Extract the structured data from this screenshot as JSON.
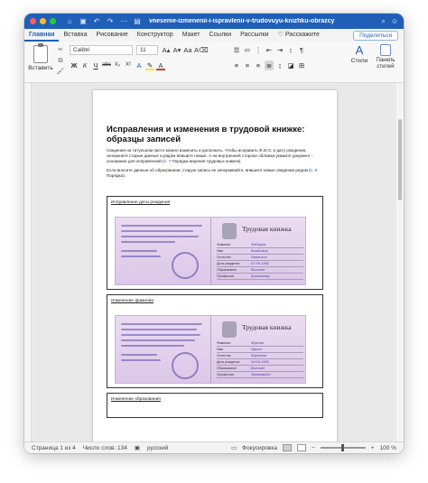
{
  "window": {
    "title": "vnesenie-izmenenii-i-ispravlenii-v-trudovuyu-knizhku-obrazcy"
  },
  "quick_access": [
    "home-icon",
    "save-icon",
    "undo-icon",
    "redo-icon",
    "more-icon",
    "word-doc-icon"
  ],
  "tabs": {
    "items": [
      "Главная",
      "Вставка",
      "Рисование",
      "Конструктор",
      "Макет",
      "Ссылки",
      "Рассылки"
    ],
    "active": "Главная",
    "tell_me": "Расскажите",
    "share": "Поделиться"
  },
  "ribbon": {
    "paste_label": "Вставить",
    "font_name": "Calibri",
    "font_size": "11",
    "bold": "Ж",
    "italic": "К",
    "underline": "Ч",
    "strike": "abc",
    "subscript": "X₂",
    "superscript": "X²",
    "styles_label": "Стили",
    "styles_pane_label": "Панель стилей"
  },
  "document": {
    "heading": "Исправления и изменения в трудовой книжке: образцы записей",
    "para1_start": "Сведения на титульном листе можно изменить и дополнить. Чтобы исправить Ф.И.О. и дату рождения, зачеркните старые данные и рядом впишите новые. А на внутренней стороне обложки укажите документ - основание для исправлений (",
    "para1_link": "п. 7",
    "para1_end": " Порядка ведения трудовых книжек).",
    "para2_start": "Если вносите данные об образовании, старую запись не зачеркивайте, впишите новые сведения рядом (",
    "para2_link": "п. 8",
    "para2_end": " Порядка).",
    "example1": {
      "label": "Исправление даты рождения",
      "book_title": "Трудовая книжка",
      "fields": [
        {
          "label": "Фамилия",
          "value": "Фёдоров"
        },
        {
          "label": "Имя",
          "value": "Владимир"
        },
        {
          "label": "Отчество",
          "value": "Иванович"
        },
        {
          "label": "Дата рождения",
          "value": "07.06.1992"
        },
        {
          "label": "Образование",
          "value": "Высшее"
        },
        {
          "label": "Профессия",
          "value": "Бухгалтер"
        }
      ]
    },
    "example2": {
      "label": "Изменение фамилии",
      "book_title": "Трудовая книжка",
      "fields": [
        {
          "label": "Фамилия",
          "value": "Жукова"
        },
        {
          "label": "Имя",
          "value": "Ирина"
        },
        {
          "label": "Отчество",
          "value": "Юрьевна"
        },
        {
          "label": "Дата рождения",
          "value": "14.04.1991"
        },
        {
          "label": "Образование",
          "value": "Высшее"
        },
        {
          "label": "Профессия",
          "value": "Экономист"
        }
      ]
    },
    "example3": {
      "label": "Изменение образования"
    }
  },
  "statusbar": {
    "page": "Страница 1 из 4",
    "words": "Число слов: 134",
    "language": "русский",
    "focus": "Фокусировка",
    "zoom": "100 %"
  }
}
